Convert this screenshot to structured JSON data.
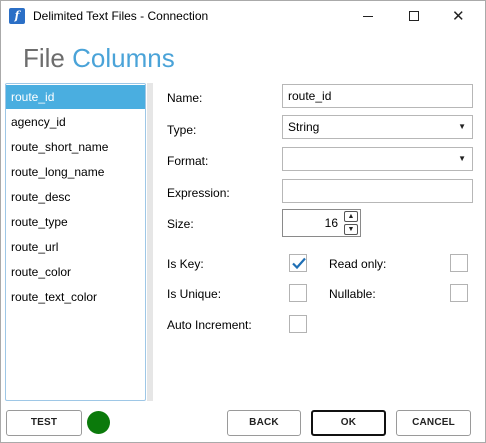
{
  "window": {
    "title": "Delimited Text Files - Connection",
    "minimize_icon": "minimize-icon",
    "maximize_icon": "maximize-icon",
    "close_icon": "close-icon"
  },
  "heading": {
    "part1": "File",
    "part2": "Columns",
    "color_part1": "#6d6d6d",
    "color_part2": "#4aa3d8"
  },
  "columns": {
    "items": [
      "route_id",
      "agency_id",
      "route_short_name",
      "route_long_name",
      "route_desc",
      "route_type",
      "route_url",
      "route_color",
      "route_text_color"
    ],
    "selected": "route_id",
    "selected_color": "#4aaee0"
  },
  "form": {
    "name_label": "Name:",
    "name_value": "route_id",
    "type_label": "Type:",
    "type_value": "String",
    "format_label": "Format:",
    "format_value": "",
    "expression_label": "Expression:",
    "expression_value": "",
    "size_label": "Size:",
    "size_value": "16",
    "is_key_label": "Is Key:",
    "is_key": true,
    "read_only_label": "Read only:",
    "read_only": false,
    "is_unique_label": "Is Unique:",
    "is_unique": false,
    "nullable_label": "Nullable:",
    "nullable": false,
    "auto_increment_label": "Auto Increment:",
    "auto_increment": false
  },
  "buttons": {
    "test": "TEST",
    "back": "BACK",
    "ok": "OK",
    "cancel": "CANCEL"
  },
  "status": {
    "color": "#0b7a0b",
    "state": "connected"
  }
}
